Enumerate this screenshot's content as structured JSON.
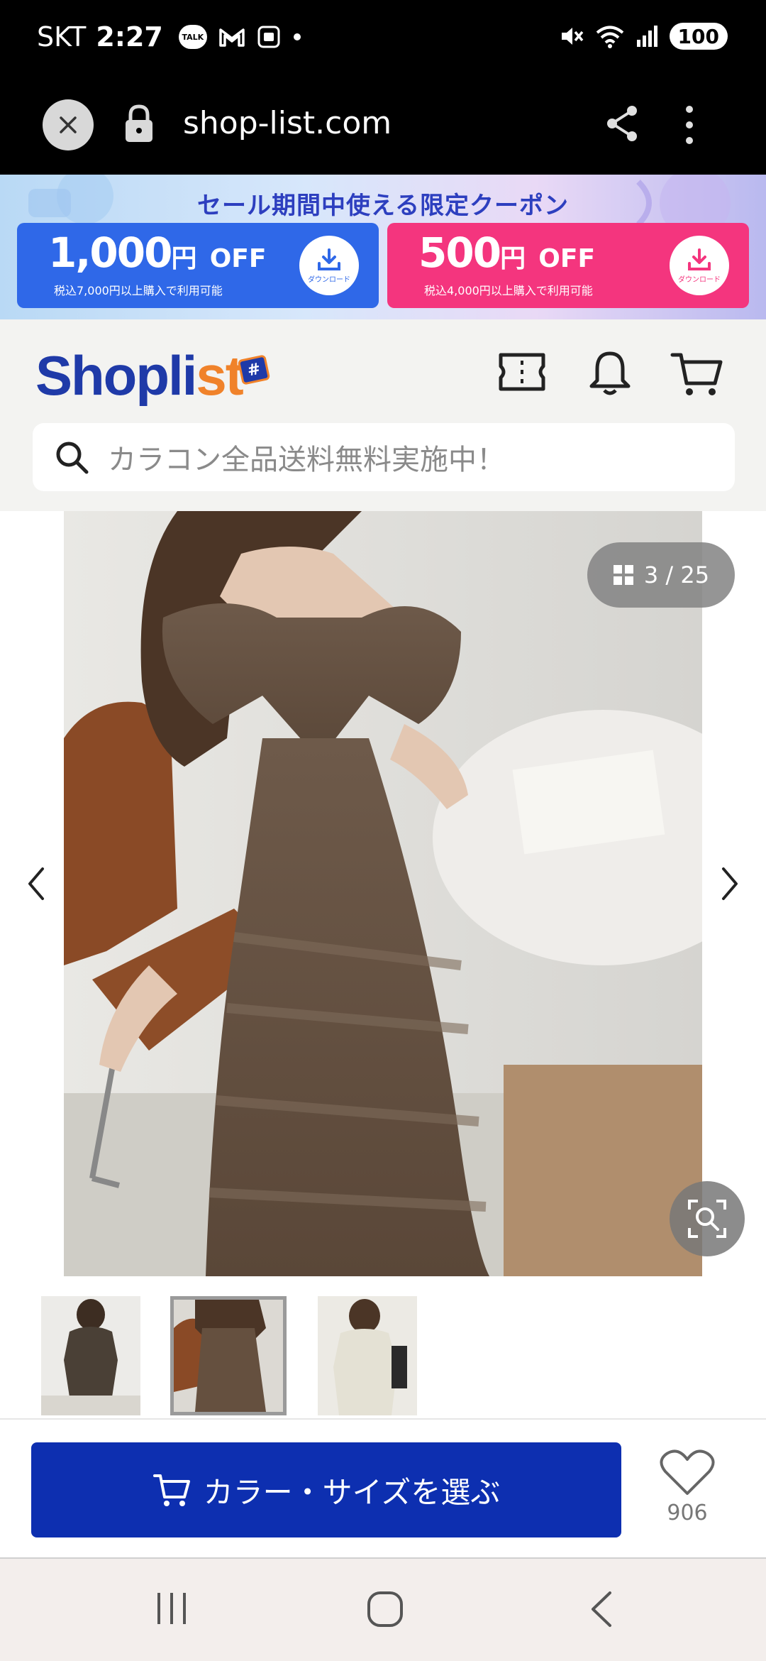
{
  "status_bar": {
    "carrier": "SKT",
    "time": "2:27",
    "battery": "100",
    "talk_badge": "TALK"
  },
  "browser": {
    "url": "shop-list.com"
  },
  "promo": {
    "title": "セール期間中使える限定クーポン",
    "coupons": [
      {
        "amount": "1,000",
        "unit": "円",
        "suffix": "OFF",
        "condition": "税込7,000円以上購入で利用可能",
        "download": "ダウンロード",
        "color": "#2f68e8"
      },
      {
        "amount": "500",
        "unit": "円",
        "suffix": "OFF",
        "condition": "税込4,000円以上購入で利用可能",
        "download": "ダウンロード",
        "color": "#f4357e"
      }
    ]
  },
  "header": {
    "logo_main": "Shopli",
    "logo_accent": "st",
    "logo_tag": "#",
    "search_placeholder": "カラコン全品送料無料実施中！"
  },
  "gallery": {
    "counter": "3 / 25",
    "current_index": 3,
    "total": 25
  },
  "thumbnails": [
    {
      "alt": "thumbnail-1",
      "active": false
    },
    {
      "alt": "thumbnail-2",
      "active": true
    },
    {
      "alt": "thumbnail-3",
      "active": false
    }
  ],
  "action_bar": {
    "select_label": "カラー・サイズを選ぶ",
    "favorite_count": "906"
  },
  "colors": {
    "brand_blue": "#1f3aa8",
    "brand_orange": "#f0822a",
    "cta_blue": "#0d2fb0"
  }
}
